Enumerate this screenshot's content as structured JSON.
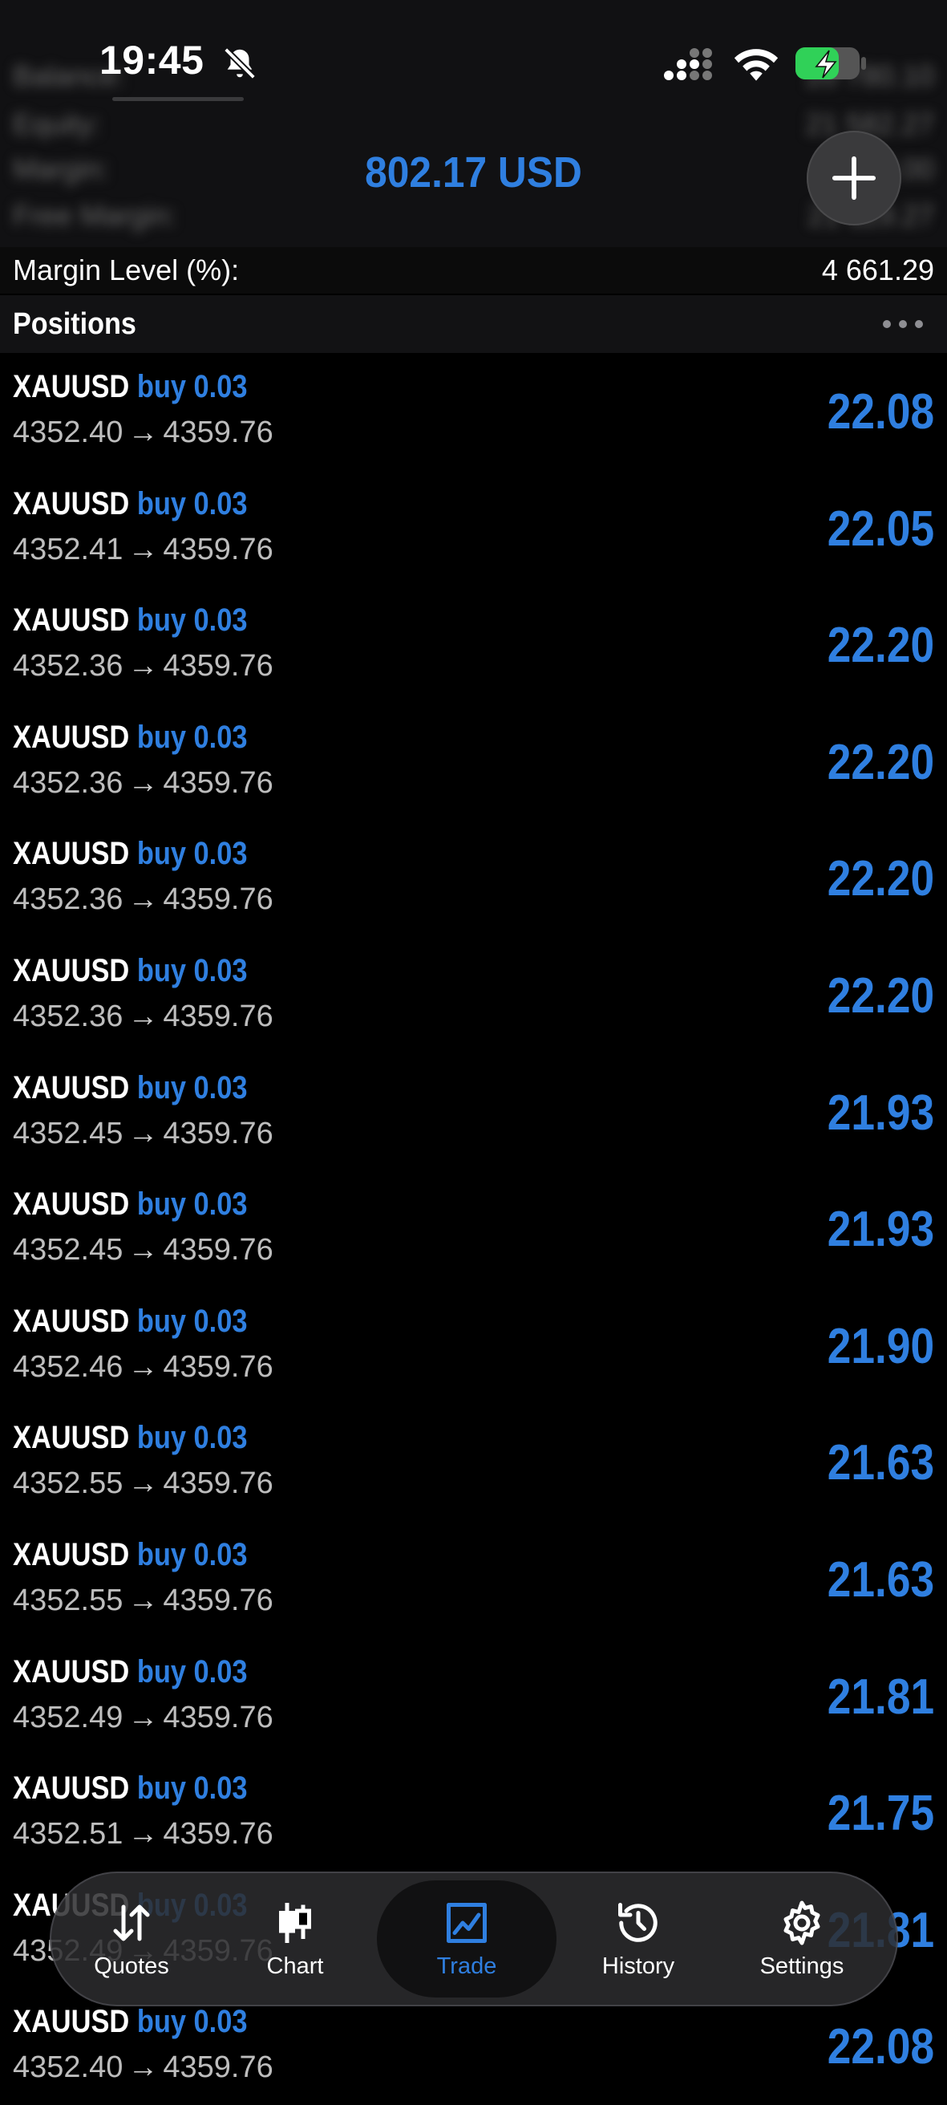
{
  "status_bar": {
    "time": "19:45"
  },
  "header": {
    "balance": "802.17 USD",
    "background_rows": [
      {
        "label": "Balance:",
        "value": "20 780.10"
      },
      {
        "label": "Equity:",
        "value": "21 582.27"
      },
      {
        "label": "Margin:",
        "value": "463.00"
      },
      {
        "label": "Free Margin:",
        "value": "21 119.27"
      }
    ]
  },
  "margin_level": {
    "label": "Margin Level (%):",
    "value": "4 661.29"
  },
  "positions": {
    "title": "Positions",
    "items": [
      {
        "symbol": "XAUUSD",
        "side": "buy 0.03",
        "open": "4352.40",
        "current": "4359.76",
        "profit": "22.08"
      },
      {
        "symbol": "XAUUSD",
        "side": "buy 0.03",
        "open": "4352.41",
        "current": "4359.76",
        "profit": "22.05"
      },
      {
        "symbol": "XAUUSD",
        "side": "buy 0.03",
        "open": "4352.36",
        "current": "4359.76",
        "profit": "22.20"
      },
      {
        "symbol": "XAUUSD",
        "side": "buy 0.03",
        "open": "4352.36",
        "current": "4359.76",
        "profit": "22.20"
      },
      {
        "symbol": "XAUUSD",
        "side": "buy 0.03",
        "open": "4352.36",
        "current": "4359.76",
        "profit": "22.20"
      },
      {
        "symbol": "XAUUSD",
        "side": "buy 0.03",
        "open": "4352.36",
        "current": "4359.76",
        "profit": "22.20"
      },
      {
        "symbol": "XAUUSD",
        "side": "buy 0.03",
        "open": "4352.45",
        "current": "4359.76",
        "profit": "21.93"
      },
      {
        "symbol": "XAUUSD",
        "side": "buy 0.03",
        "open": "4352.45",
        "current": "4359.76",
        "profit": "21.93"
      },
      {
        "symbol": "XAUUSD",
        "side": "buy 0.03",
        "open": "4352.46",
        "current": "4359.76",
        "profit": "21.90"
      },
      {
        "symbol": "XAUUSD",
        "side": "buy 0.03",
        "open": "4352.55",
        "current": "4359.76",
        "profit": "21.63"
      },
      {
        "symbol": "XAUUSD",
        "side": "buy 0.03",
        "open": "4352.55",
        "current": "4359.76",
        "profit": "21.63"
      },
      {
        "symbol": "XAUUSD",
        "side": "buy 0.03",
        "open": "4352.49",
        "current": "4359.76",
        "profit": "21.81"
      },
      {
        "symbol": "XAUUSD",
        "side": "buy 0.03",
        "open": "4352.51",
        "current": "4359.76",
        "profit": "21.75"
      },
      {
        "symbol": "XAUUSD",
        "side": "buy 0.03",
        "open": "4352.49",
        "current": "4359.76",
        "profit": "21.81"
      },
      {
        "symbol": "XAUUSD",
        "side": "buy 0.03",
        "open": "4352.40",
        "current": "4359.76",
        "profit": "22.08"
      }
    ]
  },
  "tab_bar": {
    "tabs": [
      {
        "label": "Quotes",
        "icon": "arrows-up-down-icon"
      },
      {
        "label": "Chart",
        "icon": "candlestick-icon"
      },
      {
        "label": "Trade",
        "icon": "trade-chart-icon",
        "active": true
      },
      {
        "label": "History",
        "icon": "history-clock-icon"
      },
      {
        "label": "Settings",
        "icon": "gear-icon"
      }
    ]
  },
  "colors": {
    "accent": "#2f7fe0",
    "background": "#000000",
    "battery": "#30d158"
  }
}
